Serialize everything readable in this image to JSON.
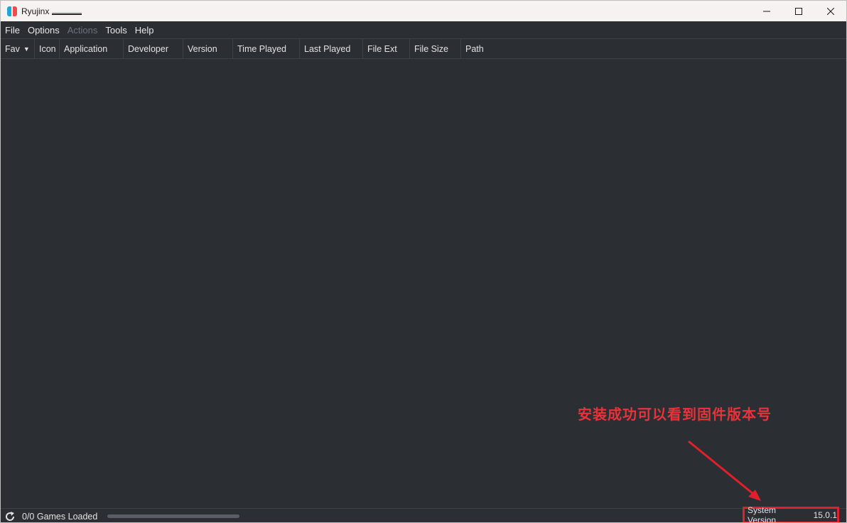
{
  "window": {
    "title": "Ryujinx"
  },
  "menu": [
    {
      "label": "File",
      "disabled": false
    },
    {
      "label": "Options",
      "disabled": false
    },
    {
      "label": "Actions",
      "disabled": true
    },
    {
      "label": "Tools",
      "disabled": false
    },
    {
      "label": "Help",
      "disabled": false
    }
  ],
  "columns": [
    {
      "label": "Fav"
    },
    {
      "label": "Icon"
    },
    {
      "label": "Application"
    },
    {
      "label": "Developer"
    },
    {
      "label": "Version"
    },
    {
      "label": "Time Played"
    },
    {
      "label": "Last Played"
    },
    {
      "label": "File Ext"
    },
    {
      "label": "File Size"
    },
    {
      "label": "Path"
    }
  ],
  "status": {
    "games_loaded": "0/0 Games Loaded",
    "system_version_label": "System Version",
    "system_version_value": "15.0.1"
  },
  "annotation": {
    "text": "安装成功可以看到固件版本号",
    "color": "#e8333a"
  },
  "colors": {
    "background": "#2b2e33",
    "highlight_box": "#e0202a"
  }
}
